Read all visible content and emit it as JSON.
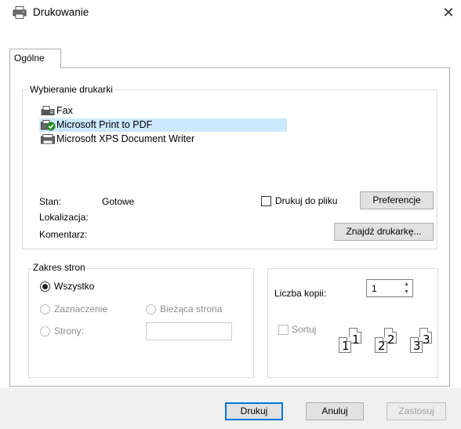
{
  "window": {
    "title": "Drukowanie",
    "close_glyph": "✕"
  },
  "tabs": [
    {
      "label": "Ogólne"
    }
  ],
  "printer_group": {
    "legend": "Wybieranie drukarki",
    "printers": [
      {
        "name": "Fax",
        "icon": "fax-icon",
        "selected": false
      },
      {
        "name": "Microsoft Print to PDF",
        "icon": "default-printer-icon",
        "selected": true
      },
      {
        "name": "Microsoft XPS Document Writer",
        "icon": "printer-icon",
        "selected": false
      }
    ],
    "status_label": "Stan:",
    "status_value": "Gotowe",
    "location_label": "Lokalizacja:",
    "comment_label": "Komentarz:",
    "print_to_file_label": "Drukuj do pliku",
    "print_to_file_checked": false,
    "preferences_button": "Preferencje",
    "find_printer_button": "Znajdź drukarkę..."
  },
  "page_range": {
    "legend": "Zakres stron",
    "all_label": "Wszystko",
    "selection_label": "Zaznaczenie",
    "current_page_label": "Bieżąca strona",
    "pages_label": "Strony:",
    "pages_value": "",
    "selected": "all"
  },
  "copies": {
    "label": "Liczba kopii:",
    "value": "1",
    "collate_label": "Sortuj",
    "collate_checked": false,
    "collate_pages": [
      "1",
      "1",
      "2",
      "2",
      "3",
      "3"
    ]
  },
  "buttons": {
    "print": "Drukuj",
    "cancel": "Anuluj",
    "apply": "Zastosuj"
  },
  "colors": {
    "selection": "#cce8ff",
    "accent": "#0078d7",
    "check_green": "#2a8a2a"
  }
}
